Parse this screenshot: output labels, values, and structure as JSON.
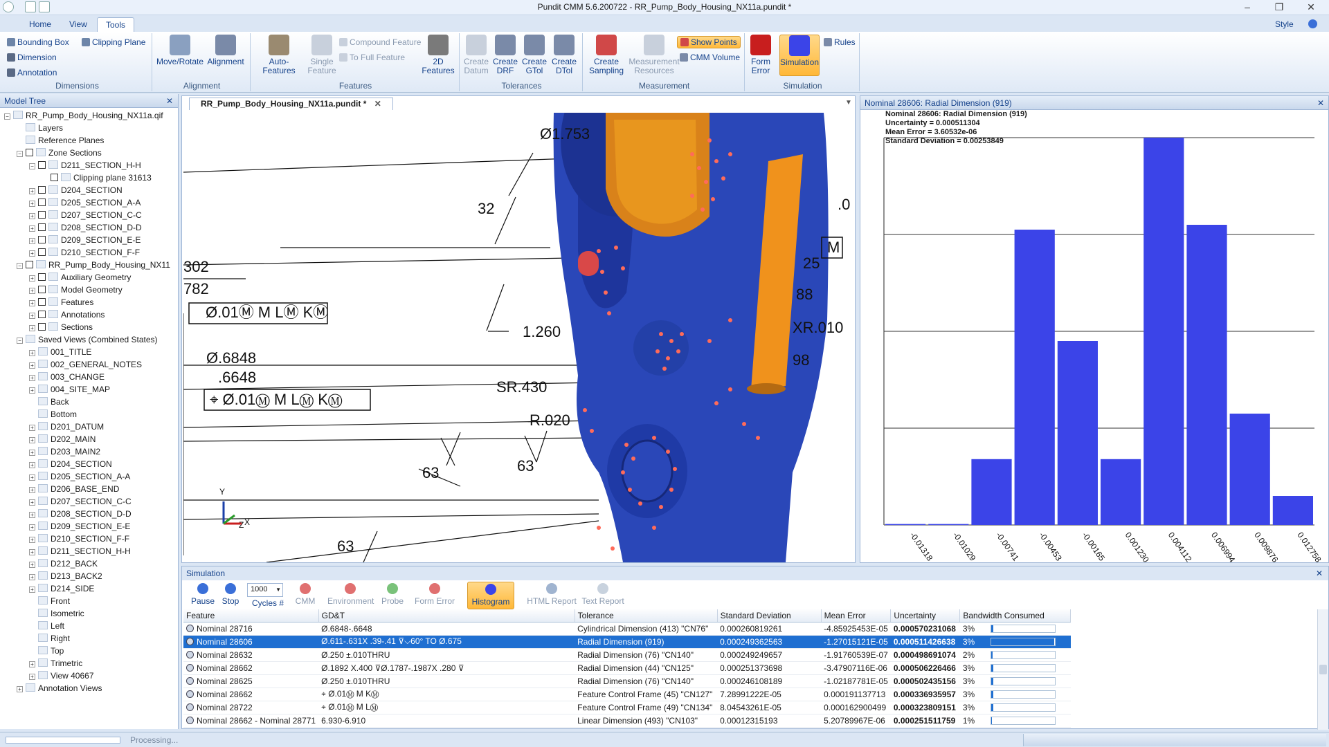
{
  "window": {
    "title": "Pundit CMM 5.6.200722 - RR_Pump_Body_Housing_NX11a.pundit *",
    "style_label": "Style"
  },
  "ribbon_tabs": [
    "Home",
    "View",
    "Tools"
  ],
  "ribbon": {
    "bounding_box": "Bounding Box",
    "clipping_plane": "Clipping Plane",
    "dimension": "Dimension",
    "annotation": "Annotation",
    "dimensions_group": "Dimensions",
    "move_rotate": "Move/Rotate",
    "alignment": "Alignment",
    "alignment_group": "Alignment",
    "auto_features": "Auto-Features",
    "single_feature": "Single Feature",
    "compound_feature": "Compound Feature",
    "to_full_feature": "To Full Feature",
    "features_2d": "2D Features",
    "features_group": "Features",
    "create_datum": "Create Datum",
    "create_drf": "Create DRF",
    "create_gtol": "Create GTol",
    "create_dtol": "Create DTol",
    "tolerances_group": "Tolerances",
    "create_sampling": "Create Sampling",
    "measurement_resources": "Measurement Resources",
    "show_points": "Show Points",
    "cmm_volume": "CMM Volume",
    "measurement_group": "Measurement",
    "form_error": "Form Error",
    "simulation": "Simulation",
    "rules": "Rules",
    "simulation_group": "Simulation"
  },
  "model_tree": {
    "header": "Model Tree",
    "items": [
      {
        "label": "RR_Pump_Body_Housing_NX11a.qif"
      },
      {
        "label": "Layers"
      },
      {
        "label": "Reference Planes"
      },
      {
        "label": "Zone Sections"
      },
      {
        "label": "D211_SECTION_H-H"
      },
      {
        "label": "Clipping plane 31613"
      },
      {
        "label": "D204_SECTION"
      },
      {
        "label": "D205_SECTION_A-A"
      },
      {
        "label": "D207_SECTION_C-C"
      },
      {
        "label": "D208_SECTION_D-D"
      },
      {
        "label": "D209_SECTION_E-E"
      },
      {
        "label": "D210_SECTION_F-F"
      },
      {
        "label": "RR_Pump_Body_Housing_NX11"
      },
      {
        "label": "Auxiliary Geometry"
      },
      {
        "label": "Model Geometry"
      },
      {
        "label": "Features"
      },
      {
        "label": "Annotations"
      },
      {
        "label": "Sections"
      },
      {
        "label": "Saved Views (Combined States)"
      },
      {
        "label": "001_TITLE"
      },
      {
        "label": "002_GENERAL_NOTES"
      },
      {
        "label": "003_CHANGE"
      },
      {
        "label": "004_SITE_MAP"
      },
      {
        "label": "Back"
      },
      {
        "label": "Bottom"
      },
      {
        "label": "D201_DATUM"
      },
      {
        "label": "D202_MAIN"
      },
      {
        "label": "D203_MAIN2"
      },
      {
        "label": "D204_SECTION"
      },
      {
        "label": "D205_SECTION_A-A"
      },
      {
        "label": "D206_BASE_END"
      },
      {
        "label": "D207_SECTION_C-C"
      },
      {
        "label": "D208_SECTION_D-D"
      },
      {
        "label": "D209_SECTION_E-E"
      },
      {
        "label": "D210_SECTION_F-F"
      },
      {
        "label": "D211_SECTION_H-H"
      },
      {
        "label": "D212_BACK"
      },
      {
        "label": "D213_BACK2"
      },
      {
        "label": "D214_SIDE"
      },
      {
        "label": "Front"
      },
      {
        "label": "Isometric"
      },
      {
        "label": "Left"
      },
      {
        "label": "Right"
      },
      {
        "label": "Top"
      },
      {
        "label": "Trimetric"
      },
      {
        "label": "View 40667"
      },
      {
        "label": "Annotation Views"
      }
    ]
  },
  "document_tab": "RR_Pump_Body_Housing_NX11a.pundit *",
  "viewport": {
    "labels": {
      "d1753": "Ø1.753",
      "n32": "32",
      "n302": "302",
      "n782": "782",
      "fcf1": "Ø.01Ⓜ M LⓂ KⓂ",
      "d6848a": "Ø.6848",
      "d6848b": ".6648",
      "fcf2": "⌖ Ø.01Ⓜ M LⓂ KⓂ",
      "n1260": "1.260",
      "sr430": "SR.430",
      "r020": "R.020",
      "n63a": "63",
      "n63b": "63",
      "n63c": "63",
      "n25": "25",
      "n88": "88",
      "xr010": "XR.010",
      "n98": "98",
      "m": "M",
      "n0": ".0",
      "axis_y": "Y",
      "axis_z": "Z",
      "axis_x": "X"
    }
  },
  "chart_panel": {
    "header": "Nominal 28606: Radial Dimension (919)",
    "stats": [
      "Nominal 28606: Radial Dimension (919)",
      "Uncertainty = 0.000511304",
      "Mean Error = 3.60532e-06",
      "Standard Deviation = 0.00253849"
    ]
  },
  "chart_data": {
    "type": "bar",
    "title": "",
    "categories": [
      "-0.01318",
      "-0.01029",
      "-0.00741",
      "-0.00453",
      "-0.00165",
      "0.001230",
      "0.004112",
      "0.006994",
      "0.009876",
      "0.012758"
    ],
    "values": [
      1,
      1,
      68,
      305,
      190,
      68,
      400,
      310,
      115,
      30
    ],
    "ylim": [
      0,
      400
    ],
    "grid": true,
    "colors": {
      "bar": "#3b44e8"
    }
  },
  "simulation": {
    "header": "Simulation",
    "tools": [
      {
        "label": "Pause",
        "color": "#3a6fd8"
      },
      {
        "label": "Stop",
        "color": "#3a6fd8"
      },
      {
        "label": "Cycles #",
        "color": "#c0c8d4"
      },
      {
        "label": "CMM",
        "color": "#e07070"
      },
      {
        "label": "Environment",
        "color": "#e07070"
      },
      {
        "label": "Probe",
        "color": "#7ac27a"
      },
      {
        "label": "Form Error",
        "color": "#e07070"
      },
      {
        "label": "Histogram",
        "color": "#3b44e8"
      },
      {
        "label": "HTML Report",
        "color": "#a0b4d0"
      },
      {
        "label": "Text Report",
        "color": "#c8d2de"
      }
    ],
    "cycles_value": "1000",
    "columns": [
      "Feature",
      "GD&T",
      "Tolerance",
      "Standard Deviation",
      "Mean Error",
      "Uncertainty",
      "Bandwidth Consumed"
    ],
    "rows": [
      {
        "feature": "Nominal 28716",
        "gdt": "Ø.6848-.6648",
        "tol": "Cylindrical Dimension (413) \"CN76\"",
        "sd": "0.000260819261",
        "me": "-4.85925453E-05",
        "unc": "0.000570231068",
        "bw": "3%",
        "bw_frac": 0.03
      },
      {
        "feature": "Nominal 28606",
        "gdt": "Ø.611-.631X .39-.41 ⊽⌵60° TO Ø.675",
        "tol": "Radial Dimension (919)",
        "sd": "0.000249362563",
        "me": "-1.27015121E-05",
        "unc": "0.000511426638",
        "bw": "3%",
        "bw_frac": 0.03
      },
      {
        "feature": "Nominal 28632",
        "gdt": "Ø.250 ±.010THRU",
        "tol": "Radial Dimension (76) \"CN140\"",
        "sd": "0.000249249657",
        "me": "-1.91760539E-07",
        "unc": "0.000498691074",
        "bw": "2%",
        "bw_frac": 0.02
      },
      {
        "feature": "Nominal 28662",
        "gdt": "Ø.1892 X.400 ⊽Ø.1787-.1987X .280 ⊽",
        "tol": "Radial Dimension (44) \"CN125\"",
        "sd": "0.000251373698",
        "me": "-3.47907116E-06",
        "unc": "0.000506226466",
        "bw": "3%",
        "bw_frac": 0.03
      },
      {
        "feature": "Nominal 28625",
        "gdt": "Ø.250 ±.010THRU",
        "tol": "Radial Dimension (76) \"CN140\"",
        "sd": "0.000246108189",
        "me": "-1.02187781E-05",
        "unc": "0.000502435156",
        "bw": "3%",
        "bw_frac": 0.03
      },
      {
        "feature": "Nominal 28662",
        "gdt": "⌖ Ø.01Ⓜ M KⓂ",
        "tol": "Feature Control Frame (45) \"CN127\"",
        "sd": "7.28991222E-05",
        "me": "0.000191137713",
        "unc": "0.000336935957",
        "bw": "3%",
        "bw_frac": 0.03
      },
      {
        "feature": "Nominal 28722",
        "gdt": "⌖ Ø.01Ⓜ M LⓂ",
        "tol": "Feature Control Frame (49) \"CN134\"",
        "sd": "8.04543261E-05",
        "me": "0.000162900499",
        "unc": "0.000323809151",
        "bw": "3%",
        "bw_frac": 0.03
      },
      {
        "feature": "Nominal 28662 - Nominal 28771",
        "gdt": "6.930-6.910",
        "tol": "Linear Dimension (493) \"CN103\"",
        "sd": "0.00012315193",
        "me": "5.20789967E-06",
        "unc": "0.000251511759",
        "bw": "1%",
        "bw_frac": 0.01
      }
    ]
  },
  "status": {
    "text": "Processing..."
  }
}
